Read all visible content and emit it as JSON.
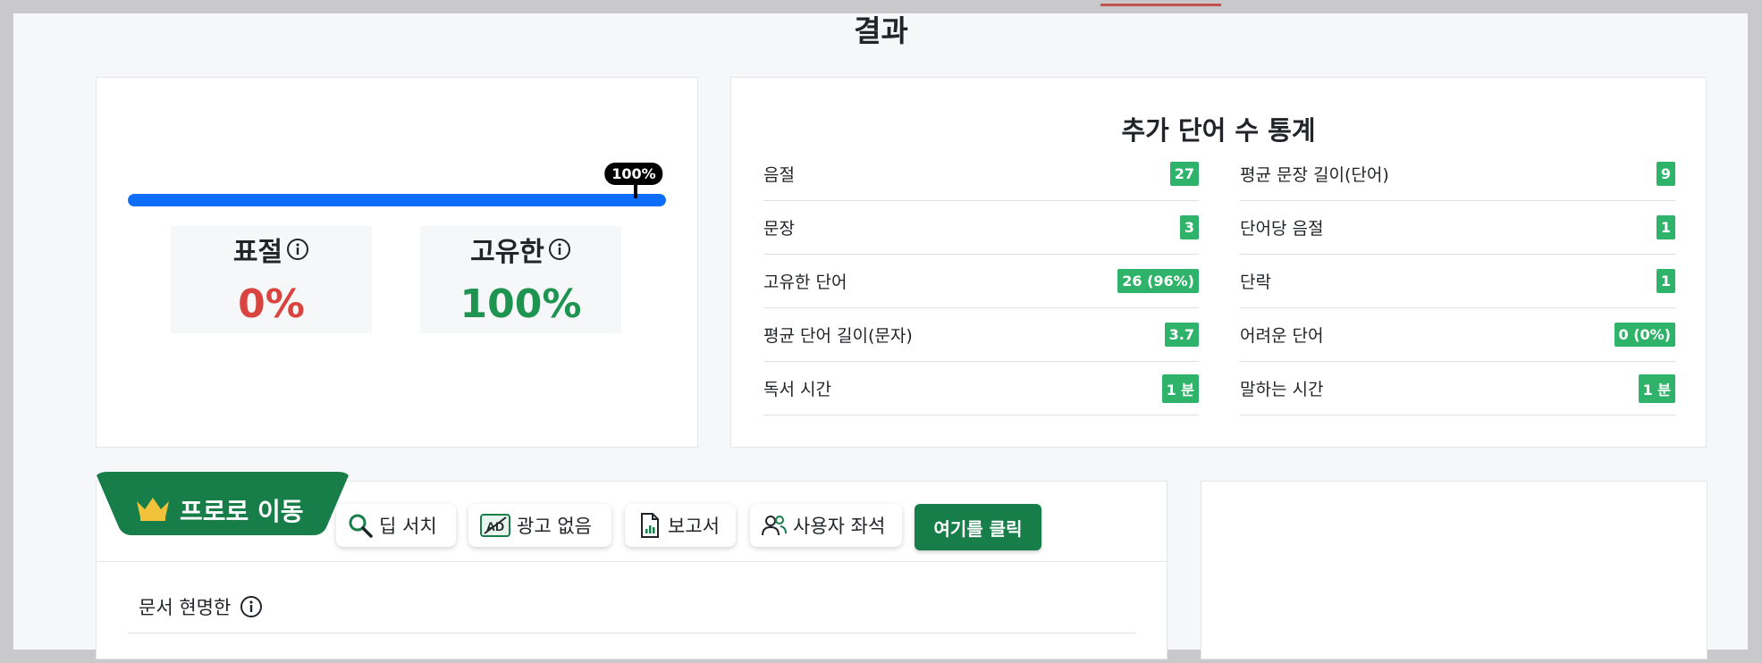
{
  "page": {
    "title": "결과"
  },
  "score": {
    "progress_percent": 100,
    "progress_label": "100%",
    "plagiarism": {
      "label": "표절",
      "value": "0%"
    },
    "unique": {
      "label": "고유한",
      "value": "100%"
    }
  },
  "stats": {
    "title": "추가 단어 수 통계",
    "left": [
      {
        "label": "음절",
        "value": "27"
      },
      {
        "label": "문장",
        "value": "3"
      },
      {
        "label": "고유한 단어",
        "value": "26 (96%)"
      },
      {
        "label": "평균 단어 길이(문자)",
        "value": "3.7"
      },
      {
        "label": "독서 시간",
        "value": "1 분"
      }
    ],
    "right": [
      {
        "label": "평균 문장 길이(단어)",
        "value": "9"
      },
      {
        "label": "단어당 음절",
        "value": "1"
      },
      {
        "label": "단락",
        "value": "1"
      },
      {
        "label": "어려운 단어",
        "value": "0 (0%)"
      },
      {
        "label": "말하는 시간",
        "value": "1 분"
      }
    ]
  },
  "pro": {
    "ribbon_label": "프로로 이동",
    "features": [
      {
        "label": "딥 서치",
        "icon": "search-icon"
      },
      {
        "label": "광고 없음",
        "icon": "ad-block-icon"
      },
      {
        "label": "보고서",
        "icon": "report-icon"
      },
      {
        "label": "사용자 좌석",
        "icon": "users-icon"
      }
    ],
    "cta_label": "여기를 클릭",
    "readability_label": "문서 현명한"
  },
  "colors": {
    "progress": "#0d6efd",
    "plagiarism": "#d9443f",
    "unique": "#1f9451",
    "badge": "#2fb36b",
    "pro_green": "#177e4a"
  }
}
